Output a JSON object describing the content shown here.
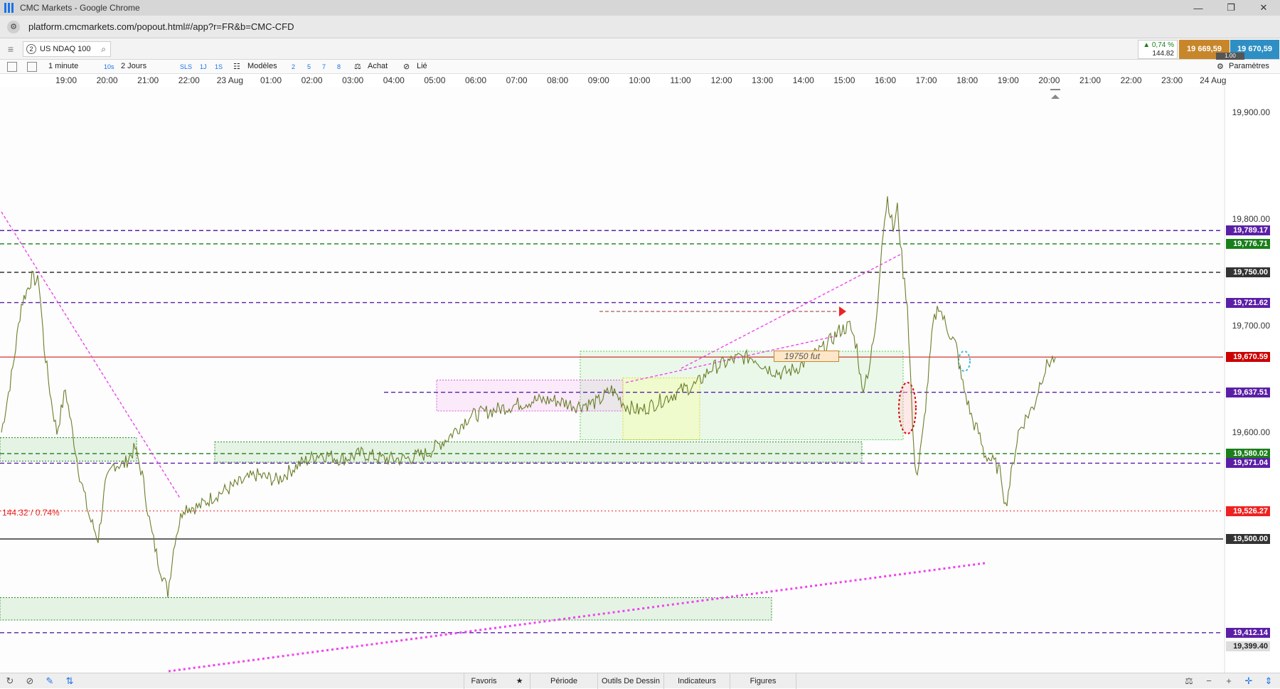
{
  "window": {
    "title": "CMC Markets - Google Chrome",
    "url": "platform.cmcmarkets.com/popout.html#/app?r=FR&b=CMC-CFD"
  },
  "instrument": {
    "index": "2",
    "name": "US NDAQ 100"
  },
  "quote": {
    "change_pct": "▲ 0,74 %",
    "change_pts": "144.82",
    "sell": "19 669,59",
    "buy": "19 670,59",
    "spread": "1.00"
  },
  "toolbar": {
    "interval": "1 minute",
    "i10s": "10s",
    "range": "2 Jours",
    "sls": "SLS",
    "t1j": "1J",
    "t1s": "1S",
    "models": "Modèles",
    "n2": "2",
    "n5": "5",
    "n7": "7",
    "n8": "8",
    "buy": "Achat",
    "linked": "Lié",
    "settings": "Paramètres"
  },
  "time_axis": [
    "19:00",
    "20:00",
    "21:00",
    "22:00",
    "23 Aug",
    "01:00",
    "02:00",
    "03:00",
    "04:00",
    "05:00",
    "06:00",
    "07:00",
    "08:00",
    "09:00",
    "10:00",
    "11:00",
    "12:00",
    "13:00",
    "14:00",
    "15:00",
    "16:00",
    "17:00",
    "18:00",
    "19:00",
    "20:00",
    "21:00",
    "22:00",
    "23:00",
    "24 Aug"
  ],
  "price_axis": [
    "19,900.00",
    "19,800.00",
    "19,700.00",
    "19,600.00"
  ],
  "price_tags": [
    {
      "label": "19,789.17",
      "color": "#5b1fa6"
    },
    {
      "label": "19,776.71",
      "color": "#1a7f1a"
    },
    {
      "label": "19,750.00",
      "color": "#333333"
    },
    {
      "label": "19,721.62",
      "color": "#5b1fa6"
    },
    {
      "label": "19,670.59",
      "color": "#cc0000"
    },
    {
      "label": "19,637.51",
      "color": "#5b1fa6"
    },
    {
      "label": "19,580.02",
      "color": "#1a7f1a"
    },
    {
      "label": "19,571.04",
      "color": "#5b1fa6"
    },
    {
      "label": "19,526.27",
      "color": "#ee2222"
    },
    {
      "label": "19,500.00",
      "color": "#333333"
    },
    {
      "label": "19,412.14",
      "color": "#5b1fa6"
    },
    {
      "label": "19,399.40",
      "color": "#dddddd"
    }
  ],
  "annotations": {
    "change": "144.32 / 0.74%",
    "alert": "19750  fut"
  },
  "bottom": {
    "favorites": "Favoris",
    "period": "Période",
    "drawing": "Outils De Dessin",
    "indicators": "Indicateurs",
    "figures": "Figures"
  }
}
